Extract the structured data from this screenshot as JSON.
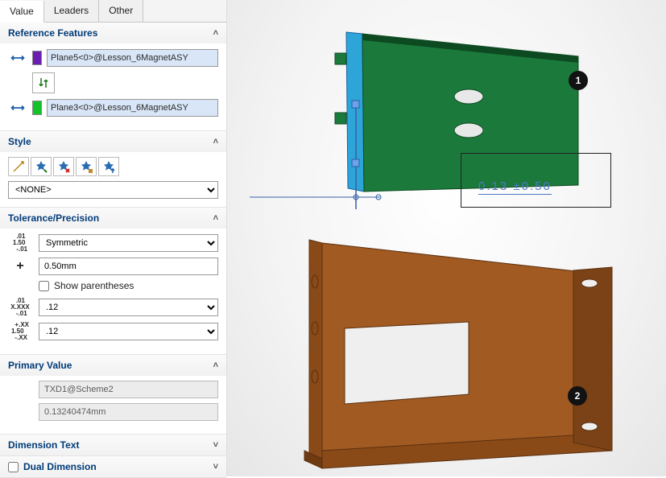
{
  "tabs": {
    "value": "Value",
    "leaders": "Leaders",
    "other": "Other"
  },
  "reference_features": {
    "title": "Reference Features",
    "items": [
      {
        "color": "#6a1eb0",
        "text": "Plane5<0>@Lesson_6MagnetASY"
      },
      {
        "color": "#15c22a",
        "text": "Plane3<0>@Lesson_6MagnetASY"
      }
    ]
  },
  "style": {
    "title": "Style",
    "value": "<NONE>"
  },
  "tolerance": {
    "title": "Tolerance/Precision",
    "type": "Symmetric",
    "value": "0.50mm",
    "show_parens_label": "Show parentheses",
    "show_parens": false,
    "unit_precision": ".12",
    "tol_precision": ".12"
  },
  "primary_value": {
    "title": "Primary Value",
    "name": "TXD1@Scheme2",
    "value": "0.13240474mm"
  },
  "dimension_text": {
    "title": "Dimension Text"
  },
  "dual_dimension": {
    "title": "Dual Dimension",
    "checked": false
  },
  "viewport": {
    "dimension": {
      "nominal": "0.13",
      "tolerance": "±0.50"
    },
    "callouts": [
      "1",
      "2"
    ],
    "colors": {
      "top_plate": "#1b7a3b",
      "top_plate_edge": "#2da5d8",
      "bottom_plate": "#a15a21",
      "feature_green": "#1b7a3b"
    }
  }
}
